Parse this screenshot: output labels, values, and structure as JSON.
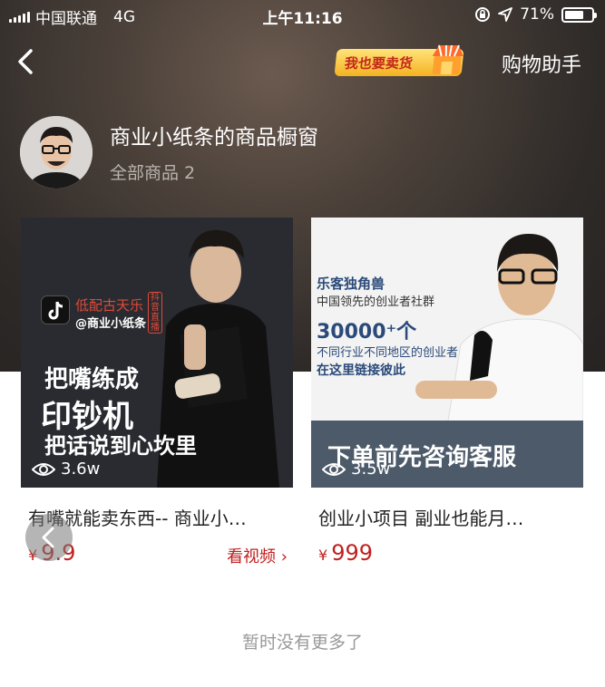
{
  "status_bar": {
    "carrier": "中国联通",
    "network": "4G",
    "time": "上午11:16",
    "battery": "71%",
    "battery_level": 0.71
  },
  "nav": {
    "sell_badge": "我也要卖货",
    "assistant": "购物助手"
  },
  "shop": {
    "title": "商业小纸条的商品橱窗",
    "count_text": "全部商品 2"
  },
  "products": [
    {
      "views": "3.6w",
      "title": "有嘴就能卖东西-- 商业小…",
      "currency": "¥",
      "price": "9.9",
      "video_link": "看视频",
      "poster": {
        "tiktok_line1": "低配古天乐",
        "tiktok_line2": "@商业小纸条",
        "tag": "抖音直播",
        "line1": "把嘴练成",
        "line2": "印钞机",
        "line3": "把话说到心坎里"
      }
    },
    {
      "views": "3.5w",
      "title": "创业小项目  副业也能月…",
      "currency": "¥",
      "price": "999",
      "poster": {
        "brand": "乐客独角兽",
        "sub": "中国领先的创业者社群",
        "big": "30000⁺个",
        "line1": "不同行业不同地区的创业者",
        "line2": "在这里链接彼此",
        "banner": "下单前先咨询客服"
      }
    }
  ],
  "footer": {
    "no_more": "暂时没有更多了"
  }
}
